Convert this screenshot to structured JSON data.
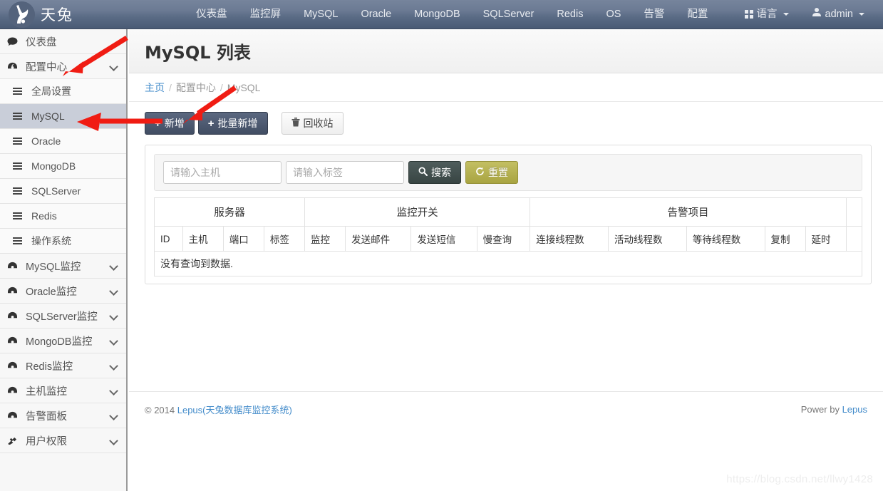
{
  "navbar": {
    "brand": "天兔",
    "logo_icon": "rabbit-logo-icon",
    "items": [
      {
        "label": "仪表盘",
        "name": "nav-dashboard"
      },
      {
        "label": "监控屏",
        "name": "nav-monitor-screen"
      },
      {
        "label": "MySQL",
        "name": "nav-mysql"
      },
      {
        "label": "Oracle",
        "name": "nav-oracle"
      },
      {
        "label": "MongoDB",
        "name": "nav-mongodb"
      },
      {
        "label": "SQLServer",
        "name": "nav-sqlserver"
      },
      {
        "label": "Redis",
        "name": "nav-redis"
      },
      {
        "label": "OS",
        "name": "nav-os"
      },
      {
        "label": "告警",
        "name": "nav-alarm"
      },
      {
        "label": "配置",
        "name": "nav-config"
      }
    ],
    "language": "语言",
    "user": "admin"
  },
  "sidebar": {
    "items": [
      {
        "label": "仪表盘",
        "icon": "comment-icon",
        "type": "top",
        "chevron": false,
        "active": false
      },
      {
        "label": "配置中心",
        "icon": "dashboard-icon",
        "type": "top",
        "chevron": true,
        "active": false
      },
      {
        "label": "全局设置",
        "icon": "list-icon",
        "type": "sub",
        "chevron": false,
        "active": false
      },
      {
        "label": "MySQL",
        "icon": "list-icon",
        "type": "sub",
        "chevron": false,
        "active": true
      },
      {
        "label": "Oracle",
        "icon": "list-icon",
        "type": "sub",
        "chevron": false,
        "active": false
      },
      {
        "label": "MongoDB",
        "icon": "list-icon",
        "type": "sub",
        "chevron": false,
        "active": false
      },
      {
        "label": "SQLServer",
        "icon": "list-icon",
        "type": "sub",
        "chevron": false,
        "active": false
      },
      {
        "label": "Redis",
        "icon": "list-icon",
        "type": "sub",
        "chevron": false,
        "active": false
      },
      {
        "label": "操作系统",
        "icon": "list-icon",
        "type": "sub",
        "chevron": false,
        "active": false
      },
      {
        "label": "MySQL监控",
        "icon": "dashboard-icon",
        "type": "top",
        "chevron": true,
        "active": false
      },
      {
        "label": "Oracle监控",
        "icon": "dashboard-icon",
        "type": "top",
        "chevron": true,
        "active": false
      },
      {
        "label": "SQLServer监控",
        "icon": "dashboard-icon",
        "type": "top",
        "chevron": true,
        "active": false
      },
      {
        "label": "MongoDB监控",
        "icon": "dashboard-icon",
        "type": "top",
        "chevron": true,
        "active": false
      },
      {
        "label": "Redis监控",
        "icon": "dashboard-icon",
        "type": "top",
        "chevron": true,
        "active": false
      },
      {
        "label": "主机监控",
        "icon": "dashboard-icon",
        "type": "top",
        "chevron": true,
        "active": false
      },
      {
        "label": "告警面板",
        "icon": "dashboard-icon",
        "type": "top",
        "chevron": true,
        "active": false
      },
      {
        "label": "用户权限",
        "icon": "user-permission-icon",
        "type": "top",
        "chevron": true,
        "active": false
      }
    ]
  },
  "page": {
    "title": "MySQL 列表",
    "breadcrumb": {
      "home": "主页",
      "sep1": "/",
      "middle": "配置中心",
      "sep2": "/",
      "current": "MySQL"
    }
  },
  "toolbar": {
    "add_label": "新增",
    "batch_add_label": "批量新增",
    "recycle_label": "回收站",
    "plus": "+",
    "trash_icon": "trash-icon"
  },
  "search": {
    "host_placeholder": "请输入主机",
    "tag_placeholder": "请输入标签",
    "host_value": "",
    "tag_value": "",
    "search_label": "搜索",
    "reset_label": "重置",
    "search_icon": "search-icon",
    "reset_icon": "refresh-icon"
  },
  "table": {
    "group_headers": [
      {
        "label": "服务器",
        "span": 4
      },
      {
        "label": "监控开关",
        "span": 4
      },
      {
        "label": "告警项目",
        "span": 5
      },
      {
        "label": "",
        "span": 1
      }
    ],
    "columns": [
      "ID",
      "主机",
      "端口",
      "标签",
      "监控",
      "发送邮件",
      "发送短信",
      "慢查询",
      "连接线程数",
      "活动线程数",
      "等待线程数",
      "复制",
      "延时",
      ""
    ],
    "rows": [],
    "empty_message": "没有查询到数据."
  },
  "footer": {
    "copyright_prefix": "© 2014 ",
    "copyright_link": "Lepus(天兔数据库监控系统)",
    "power_prefix": "Power by ",
    "power_link": "Lepus"
  },
  "watermark": "https://blog.csdn.net/llwy1428",
  "colors": {
    "navbar": "#5d6e88",
    "accent_link": "#428bca",
    "error_text": "#ef3b36",
    "reset_button": "#b3af52",
    "sidebar_active": "#c9ced9",
    "annotation_arrow": "#f01c13"
  }
}
